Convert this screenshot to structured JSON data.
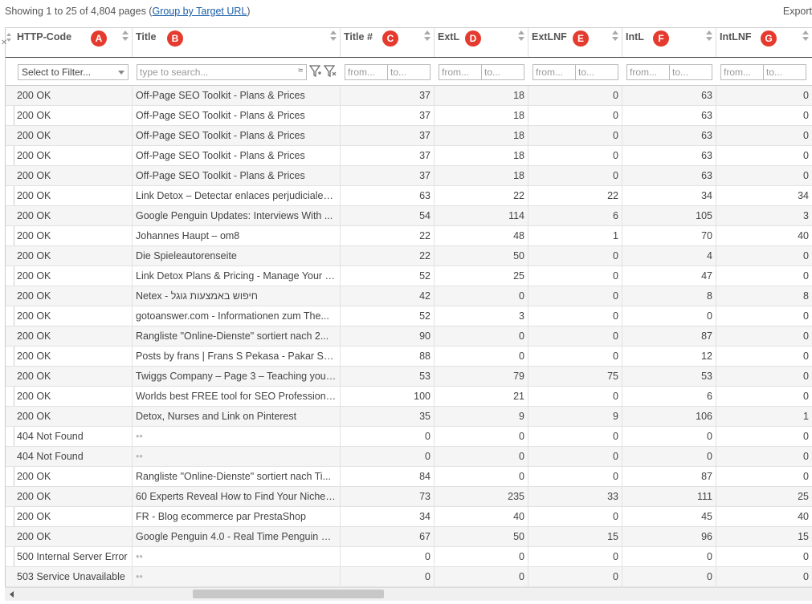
{
  "summary": {
    "prefix": "Showing 1 to 25 of 4,804 pages (",
    "link": "Group by Target URL",
    "suffix": ")"
  },
  "toolbar": {
    "export_label": "Export"
  },
  "columns": [
    {
      "key": "http",
      "label": "HTTP-Code",
      "badge": "A"
    },
    {
      "key": "title",
      "label": "Title",
      "badge": "B"
    },
    {
      "key": "titlenum",
      "label": "Title #",
      "badge": "C"
    },
    {
      "key": "extl",
      "label": "ExtL",
      "badge": "D"
    },
    {
      "key": "extlnf",
      "label": "ExtLNF",
      "badge": "E"
    },
    {
      "key": "intl",
      "label": "IntL",
      "badge": "F"
    },
    {
      "key": "intlnf",
      "label": "IntLNF",
      "badge": "G"
    }
  ],
  "filters": {
    "http_select": "Select to Filter...",
    "title_placeholder": "type to search...",
    "from_placeholder": "from...",
    "to_placeholder": "to..."
  },
  "rows": [
    [
      "200 OK",
      "Off-Page SEO Toolkit - Plans & Prices",
      "37",
      "18",
      "0",
      "63",
      "0"
    ],
    [
      "200 OK",
      "Off-Page SEO Toolkit - Plans & Prices",
      "37",
      "18",
      "0",
      "63",
      "0"
    ],
    [
      "200 OK",
      "Off-Page SEO Toolkit - Plans & Prices",
      "37",
      "18",
      "0",
      "63",
      "0"
    ],
    [
      "200 OK",
      "Off-Page SEO Toolkit - Plans & Prices",
      "37",
      "18",
      "0",
      "63",
      "0"
    ],
    [
      "200 OK",
      "Off-Page SEO Toolkit - Plans & Prices",
      "37",
      "18",
      "0",
      "63",
      "0"
    ],
    [
      "200 OK",
      "Link Detox – Detectar enlaces perjudiciales...",
      "63",
      "22",
      "22",
      "34",
      "34"
    ],
    [
      "200 OK",
      "Google Penguin Updates: Interviews With ...",
      "54",
      "114",
      "6",
      "105",
      "3"
    ],
    [
      "200 OK",
      "Johannes Haupt – om8",
      "22",
      "48",
      "1",
      "70",
      "40"
    ],
    [
      "200 OK",
      "Die Spieleautorenseite",
      "22",
      "50",
      "0",
      "4",
      "0"
    ],
    [
      "200 OK",
      "Link Detox Plans & Pricing - Manage Your L...",
      "52",
      "25",
      "0",
      "47",
      "0"
    ],
    [
      "200 OK",
      "Netex - חיפוש באמצעות גוגל",
      "42",
      "0",
      "0",
      "8",
      "8"
    ],
    [
      "200 OK",
      "gotoanswer.com - Informationen zum The...",
      "52",
      "3",
      "0",
      "0",
      "0"
    ],
    [
      "200 OK",
      "Rangliste \"Online-Dienste\" sortiert nach 2...",
      "90",
      "0",
      "0",
      "87",
      "0"
    ],
    [
      "200 OK",
      "Posts by frans | Frans S Pekasa - Pakar SE...",
      "88",
      "0",
      "0",
      "12",
      "0"
    ],
    [
      "200 OK",
      "Twiggs Company – Page 3 – Teaching you t...",
      "53",
      "79",
      "75",
      "53",
      "0"
    ],
    [
      "200 OK",
      "Worlds best FREE tool for SEO Professional...",
      "100",
      "21",
      "0",
      "6",
      "0"
    ],
    [
      "200 OK",
      "Detox, Nurses and Link on Pinterest",
      "35",
      "9",
      "9",
      "106",
      "1"
    ],
    [
      "404 Not Found",
      "••",
      "0",
      "0",
      "0",
      "0",
      "0"
    ],
    [
      "404 Not Found",
      "••",
      "0",
      "0",
      "0",
      "0",
      "0"
    ],
    [
      "200 OK",
      "Rangliste \"Online-Dienste\" sortiert nach Ti...",
      "84",
      "0",
      "0",
      "87",
      "0"
    ],
    [
      "200 OK",
      "60 Experts Reveal How to Find Your Niche ...",
      "73",
      "235",
      "33",
      "111",
      "25"
    ],
    [
      "200 OK",
      "FR - Blog ecommerce par PrestaShop",
      "34",
      "40",
      "0",
      "45",
      "40"
    ],
    [
      "200 OK",
      "Google Penguin 4.0 - Real Time Penguin pa...",
      "67",
      "50",
      "15",
      "96",
      "15"
    ],
    [
      "500 Internal Server Error",
      "••",
      "0",
      "0",
      "0",
      "0",
      "0"
    ],
    [
      "503 Service Unavailable",
      "••",
      "0",
      "0",
      "0",
      "0",
      "0"
    ]
  ]
}
